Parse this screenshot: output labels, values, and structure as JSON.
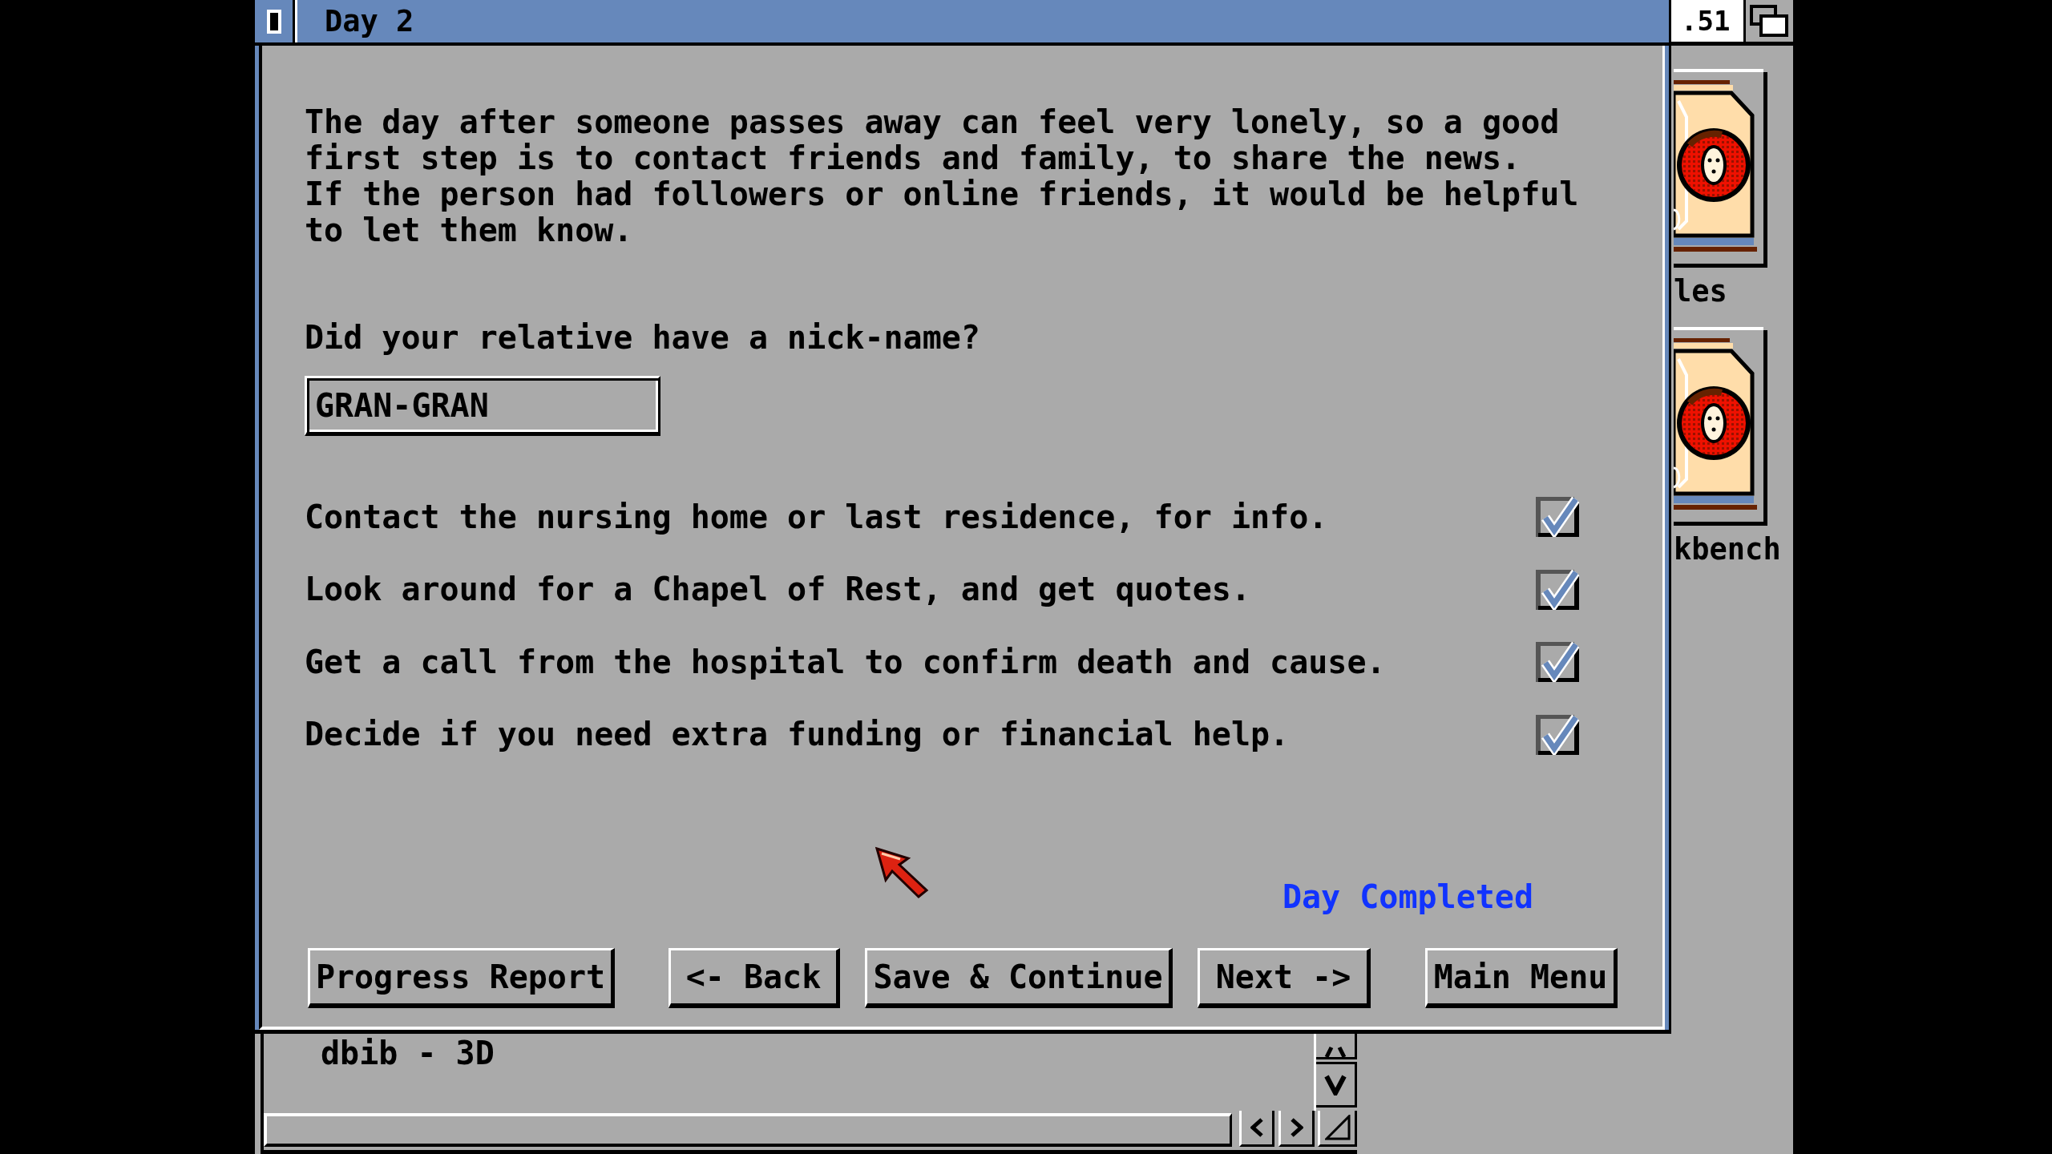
{
  "window": {
    "title": "Day 2",
    "intro": "The day after someone passes away can feel very lonely, so a good\nfirst step is to contact friends and family, to share the news.\nIf the person had followers or online friends, it would be helpful\nto let them know.",
    "question": "Did your relative have a nick-name?",
    "nickname_field": {
      "value": "GRAN-GRAN"
    },
    "tasks": [
      {
        "label": "Contact the nursing home or last residence, for info.",
        "checked": true
      },
      {
        "label": "Look around for a Chapel of Rest, and get quotes.",
        "checked": true
      },
      {
        "label": "Get a call from the hospital to confirm death and cause.",
        "checked": true
      },
      {
        "label": "Decide if you need extra funding or financial help.",
        "checked": true
      }
    ],
    "status": "Day Completed",
    "buttons": [
      "Progress Report",
      "<- Back",
      "Save & Continue",
      "Next ->",
      "Main Menu"
    ]
  },
  "screen_title": ".51",
  "desktop_icons": [
    {
      "label": "les"
    },
    {
      "label": "kbench"
    }
  ],
  "background_window": {
    "text": "dbib - 3D"
  }
}
